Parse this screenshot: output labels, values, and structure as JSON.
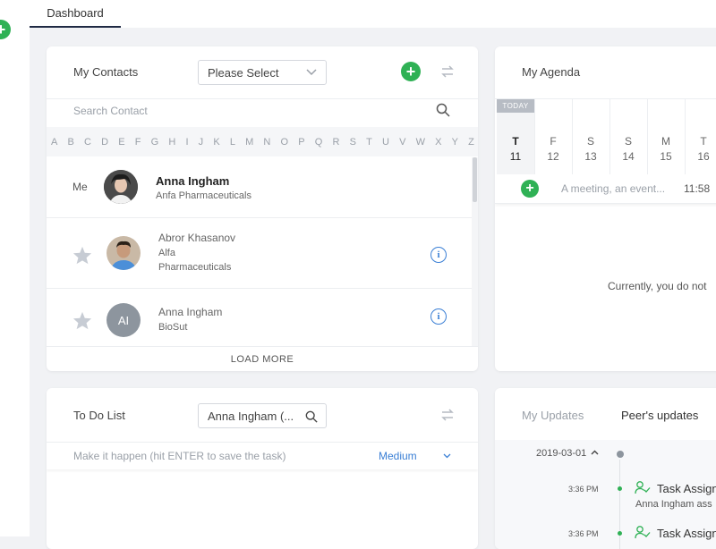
{
  "nav": {
    "tab_label": "Dashboard",
    "fab": "+"
  },
  "contacts": {
    "title": "My Contacts",
    "select_value": "Please Select",
    "search_placeholder": "Search Contact",
    "letters": [
      "A",
      "B",
      "C",
      "D",
      "E",
      "F",
      "G",
      "H",
      "I",
      "J",
      "K",
      "L",
      "M",
      "N",
      "O",
      "P",
      "Q",
      "R",
      "S",
      "T",
      "U",
      "V",
      "W",
      "X",
      "Y",
      "Z"
    ],
    "me_label": "Me",
    "me": {
      "name": "Anna Ingham",
      "company": "Anfa Pharmaceuticals"
    },
    "items": [
      {
        "name": "Abror Khasanov",
        "company_line1": "Alfa",
        "company_line2": "Pharmaceuticals"
      },
      {
        "name": "Anna Ingham",
        "company_line1": "BioSut",
        "initials": "AI"
      }
    ],
    "load_more": "LOAD MORE"
  },
  "agenda": {
    "title": "My Agenda",
    "today_badge": "TODAY",
    "days": [
      {
        "letter": "T",
        "num": "11"
      },
      {
        "letter": "F",
        "num": "12"
      },
      {
        "letter": "S",
        "num": "13"
      },
      {
        "letter": "S",
        "num": "14"
      },
      {
        "letter": "M",
        "num": "15"
      },
      {
        "letter": "T",
        "num": "16"
      }
    ],
    "event_placeholder": "A meeting, an event...",
    "event_time": "11:58",
    "empty_text": "Currently, you do not"
  },
  "todo": {
    "title": "To Do List",
    "select_value": "Anna Ingham (...",
    "placeholder": "Make it happen (hit ENTER to save the task)",
    "priority": "Medium"
  },
  "updates": {
    "tab_mine": "My Updates",
    "tab_peers": "Peer's updates",
    "date": "2019-03-01",
    "entries": [
      {
        "time": "3:36 PM",
        "title": "Task Assign",
        "sub": "Anna Ingham ass"
      },
      {
        "time": "3:36 PM",
        "title": "Task Assign"
      }
    ]
  },
  "colors": {
    "accent_green": "#2fb155",
    "info_blue": "#3a7fd5",
    "dark_navy": "#1f2a44"
  }
}
